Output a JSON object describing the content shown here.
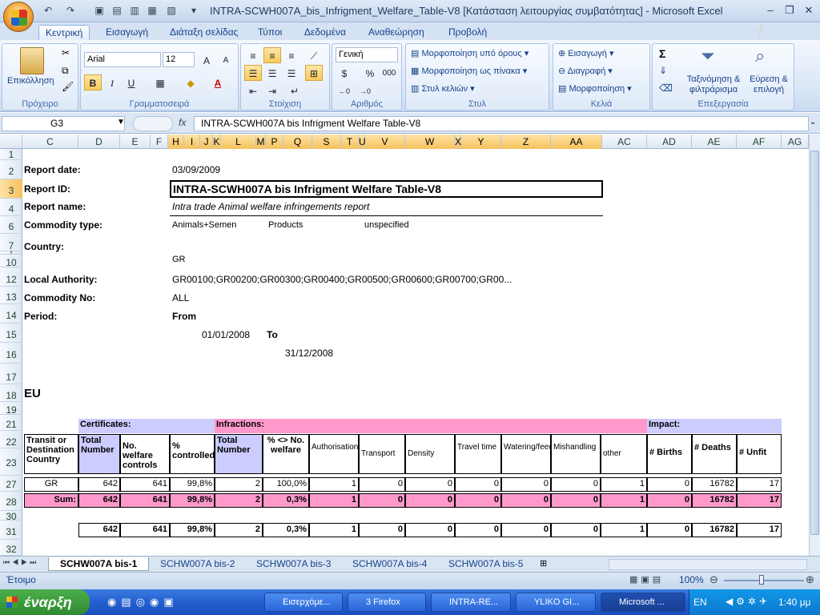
{
  "window": {
    "title": "INTRA-SCWH007A_bis_Infrigment_Welfare_Table-V8  [Κατάσταση λειτουργίας συμβατότητας] - Microsoft Excel"
  },
  "ribbon_tabs": [
    "Κεντρική",
    "Εισαγωγή",
    "Διάταξη σελίδας",
    "Τύποι",
    "Δεδομένα",
    "Αναθεώρηση",
    "Προβολή"
  ],
  "ribbon": {
    "clipboard": {
      "label": "Πρόχειρο",
      "paste": "Επικόλληση"
    },
    "font": {
      "label": "Γραμματοσειρά",
      "name": "Arial",
      "size": "12",
      "bold": "B",
      "italic": "I",
      "underline": "U"
    },
    "alignment": {
      "label": "Στοίχιση"
    },
    "number": {
      "label": "Αριθμός",
      "format": "Γενική",
      "percent": "%",
      "thousands": "000"
    },
    "styles": {
      "label": "Στυλ",
      "cond": "Μορφοποίηση υπό όρους",
      "table": "Μορφοποίηση ως πίνακα",
      "cell": "Στυλ κελιών"
    },
    "cells": {
      "label": "Κελιά",
      "insert": "Εισαγωγή",
      "delete": "Διαγραφή",
      "format": "Μορφοποίηση"
    },
    "editing": {
      "label": "Επεξεργασία",
      "sort": "Ταξινόμηση & φιλτράρισμα",
      "find": "Εύρεση & επιλογή",
      "sigma": "Σ"
    }
  },
  "formula_bar": {
    "name_box": "G3",
    "fx": "fx",
    "formula": "INTRA-SCWH007A bis Infrigment Welfare Table-V8"
  },
  "columns": [
    "C",
    "D",
    "E",
    "F",
    "H",
    "I",
    "J",
    "K",
    "L",
    "M",
    "P",
    "Q",
    "S",
    "T",
    "U",
    "V",
    "W",
    "X",
    "Y",
    "Z",
    "AA",
    "AC",
    "AD",
    "AE",
    "AF",
    "AG"
  ],
  "rows": [
    "1",
    "2",
    "3",
    "4",
    "6",
    "7",
    "9",
    "10",
    "12",
    "13",
    "14",
    "15",
    "16",
    "17",
    "18",
    "19",
    "21",
    "22",
    "23",
    "27",
    "28",
    "30",
    "31",
    "32"
  ],
  "report": {
    "date_label": "Report date:",
    "date": "03/09/2009",
    "id_label": "Report ID:",
    "id": "INTRA-SCWH007A bis Infrigment Welfare Table-V8",
    "name_label": "Report name:",
    "name": "Intra trade Animal welfare infringements report",
    "commodity_label": "Commodity type:",
    "commodity_1": "Animals+Semen",
    "commodity_2": "Products",
    "commodity_3": "unspecified",
    "country_label": "Country:",
    "country": "GR",
    "authority_label": "Local Authority:",
    "authority": "GR00100;GR00200;GR00300;GR00400;GR00500;GR00600;GR00700;GR00...",
    "commodity_no_label": "Commodity No:",
    "commodity_no": "ALL",
    "period_label": "Period:",
    "from_label": "From",
    "from_date": "01/01/2008",
    "to_label": "To",
    "to_date": "31/12/2008",
    "section": "EU"
  },
  "table": {
    "group_certificates": "Certificates:",
    "group_infractions": "Infractions:",
    "group_impact": "Impact:",
    "headers": [
      "Transit or Destination Country",
      "Total Number",
      "No. welfare controls",
      "% controlled",
      "Total Number",
      "% <> No. welfare",
      "Authorisation",
      "Transport",
      "Density",
      "Travel time",
      "Watering/feeding",
      "Mishandling",
      "other",
      "# Births",
      "# Deaths",
      "# Unfit"
    ],
    "row_gr": [
      "GR",
      "642",
      "641",
      "99,8%",
      "2",
      "100,0%",
      "1",
      "0",
      "0",
      "0",
      "0",
      "0",
      "1",
      "0",
      "16782",
      "17"
    ],
    "row_sum": [
      "Sum:",
      "642",
      "641",
      "99,8%",
      "2",
      "0,3%",
      "1",
      "0",
      "0",
      "0",
      "0",
      "0",
      "1",
      "0",
      "16782",
      "17"
    ],
    "row_total": [
      "",
      "642",
      "641",
      "99,8%",
      "2",
      "0,3%",
      "1",
      "0",
      "0",
      "0",
      "0",
      "0",
      "1",
      "0",
      "16782",
      "17"
    ]
  },
  "sheet_tabs": [
    "SCHW007A bis-1",
    "SCHW007A bis-2",
    "SCHW007A bis-3",
    "SCHW007A bis-4",
    "SCHW007A bis-5"
  ],
  "status": {
    "ready": "Έτοιμο",
    "zoom": "100%"
  },
  "taskbar": {
    "start": "έναρξη",
    "items": [
      "Εισερχόμε...",
      "3 Firefox",
      "INTRA-RE...",
      "YLIKO GI...",
      "Microsoft ..."
    ],
    "lang": "EN",
    "time": "1:40 μμ"
  }
}
